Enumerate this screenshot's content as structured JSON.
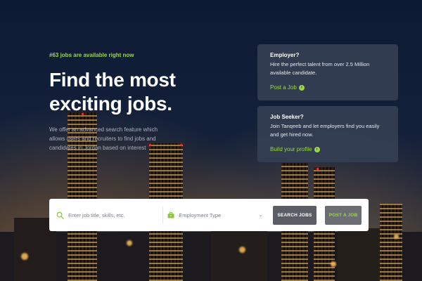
{
  "hero": {
    "jobs_available": "#63 jobs are available right now",
    "headline": "Find the most exciting jobs.",
    "description": "We offer an advanced search feature which allows users and recruiters to find jobs and candidates in Jordan based on interest"
  },
  "employer_card": {
    "title": "Employer?",
    "body": "Hire the perfect talent from over 2.5 Million available candidate.",
    "link": "Post a Job"
  },
  "jobseeker_card": {
    "title": "Job Seeker?",
    "body": "Join Tanqeeb and let employers find you easily and get hired now.",
    "link": "Build your profile"
  },
  "search": {
    "placeholder": "Enter job title, skills, etc.",
    "employment_type": "Employment Type",
    "search_button": "SEARCH JOBS",
    "post_button": "POST A JOB"
  },
  "colors": {
    "accent": "#9ad84a",
    "card_bg": "#343f54",
    "search_button": "#5a5d63"
  },
  "icons": {
    "search": "search-icon",
    "employment": "briefcase-icon",
    "dropdown": "chevron-down-icon",
    "link_arrow": "arrow-right-circle-icon"
  }
}
